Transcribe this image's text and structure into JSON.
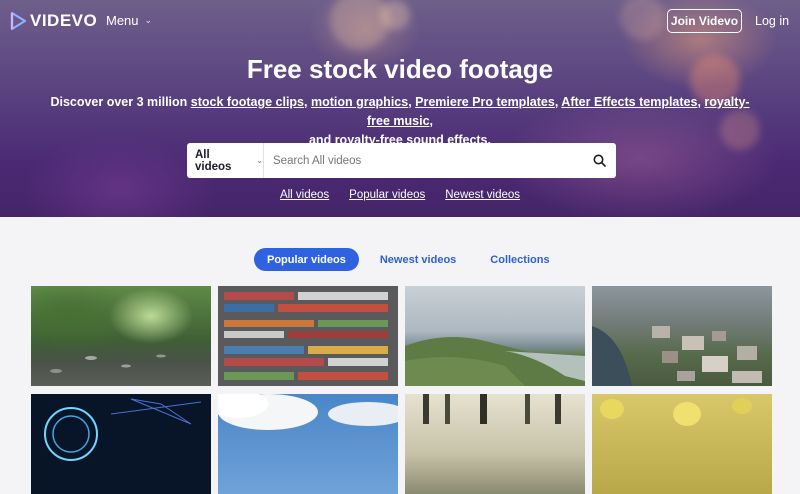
{
  "header": {
    "logo_text": "VIDEVO",
    "menu_label": "Menu",
    "join_label": "Join Videvo",
    "login_label": "Log in"
  },
  "hero": {
    "title": "Free stock video footage",
    "subtitle_prefix": "Discover over 3 million ",
    "links": [
      "stock footage clips",
      "motion graphics",
      "Premiere Pro templates",
      "After Effects templates",
      "royalty-free music",
      "royalty-free sound effects"
    ],
    "subtitle_and": "and ",
    "subtitle_end": "."
  },
  "search": {
    "type_label": "All videos",
    "placeholder": "Search All videos"
  },
  "quick_links": [
    "All videos",
    "Popular videos",
    "Newest videos"
  ],
  "tabs": [
    {
      "label": "Popular videos",
      "active": true
    },
    {
      "label": "Newest videos",
      "active": false
    },
    {
      "label": "Collections",
      "active": false
    }
  ],
  "colors": {
    "accent": "#2f62e0",
    "tab_text": "#2f5fd0"
  }
}
